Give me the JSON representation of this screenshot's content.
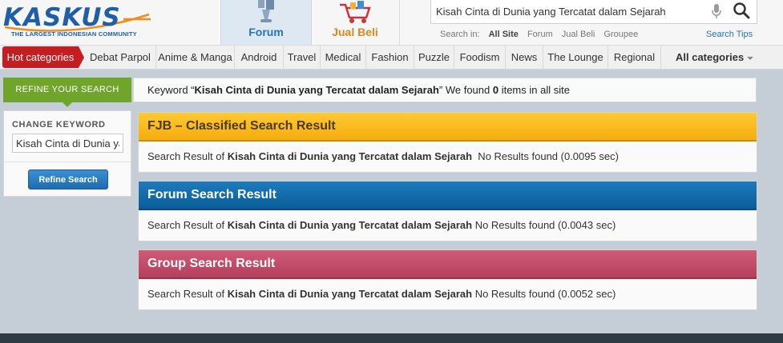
{
  "brand": {
    "logo_text": "KASKUS",
    "tagline": "THE LARGEST INDONESIAN COMMUNITY",
    "colors": {
      "logo_blue": "#1e5fa8",
      "forum_blue": "#2673b8",
      "jualbeli_orange": "#e0881a",
      "hot_red": "#c41d22",
      "refine_green": "#6fa52a"
    }
  },
  "nav": {
    "forum": {
      "label": "Forum",
      "icon": "forum-icon"
    },
    "jualbeli": {
      "label": "Jual Beli",
      "icon": "shopping-cart-icon"
    }
  },
  "search": {
    "query": "Kisah Cinta di Dunia yang Tercatat dalam Sejarah",
    "search_in_label": "Search in:",
    "scopes": [
      "All Site",
      "Forum",
      "Jual Beli",
      "Groupee"
    ],
    "active_scope": "All Site",
    "tips": "Search Tips"
  },
  "categories": {
    "hot": "Hot categories",
    "items": [
      "Debat Parpol",
      "Anime & Manga",
      "Android",
      "Travel",
      "Medical",
      "Fashion",
      "Puzzle",
      "Foodism",
      "News",
      "The Lounge",
      "Regional"
    ],
    "all": "All categories"
  },
  "refine": {
    "tab_label": "REFINE YOUR SEARCH",
    "change_keyword_label": "CHANGE KEYWORD",
    "keyword_value": "Kisah Cinta di Dunia yang Tercatat dalam Sejarah",
    "button_label": "Refine Search"
  },
  "summary": {
    "prefix": "Keyword “",
    "keyword": "Kisah Cinta di Dunia yang Tercatat dalam Sejarah",
    "middle": "” We found ",
    "count": "0",
    "suffix": " items in all site"
  },
  "results": [
    {
      "title": "FJB – Classified Search Result",
      "prefix": "Search Result of ",
      "keyword": "Kisah Cinta di Dunia yang Tercatat dalam Sejarah",
      "status": "  No Results found (0.0095 sec)"
    },
    {
      "title": "Forum Search Result",
      "prefix": "Search Result of ",
      "keyword": "Kisah Cinta di Dunia yang Tercatat dalam Sejarah",
      "status": " No Results found (0.0043 sec)"
    },
    {
      "title": "Group Search Result",
      "prefix": "Search Result of ",
      "keyword": "Kisah Cinta di Dunia yang Tercatat dalam Sejarah",
      "status": " No Results found (0.0052 sec)"
    }
  ]
}
